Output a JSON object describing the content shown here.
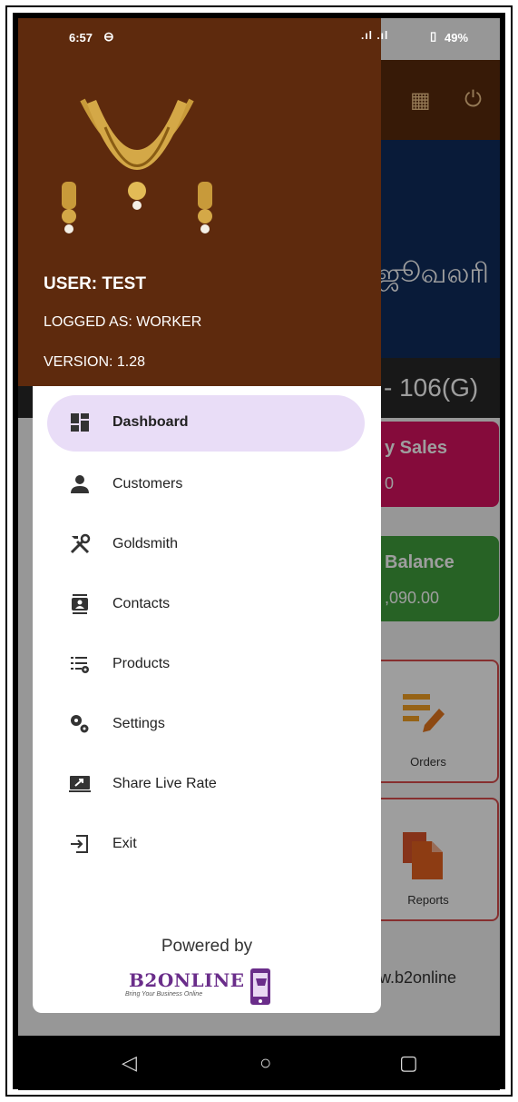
{
  "status_bar": {
    "time": "6:57",
    "signal": ".ıl .ıl",
    "battery": "49%"
  },
  "drawer": {
    "user": "USER: TEST",
    "logged_as": "LOGGED AS: WORKER",
    "version": "VERSION: 1.28",
    "menu": [
      {
        "label": "Dashboard",
        "icon": "dashboard-icon",
        "active": true
      },
      {
        "label": "Customers",
        "icon": "person-icon",
        "active": false
      },
      {
        "label": "Goldsmith",
        "icon": "tools-icon",
        "active": false
      },
      {
        "label": "Contacts",
        "icon": "contacts-icon",
        "active": false
      },
      {
        "label": "Products",
        "icon": "list-settings-icon",
        "active": false
      },
      {
        "label": "Settings",
        "icon": "gears-icon",
        "active": false
      },
      {
        "label": "Share Live Rate",
        "icon": "share-screen-icon",
        "active": false
      },
      {
        "label": "Exit",
        "icon": "exit-icon",
        "active": false
      }
    ],
    "powered_by": "Powered by",
    "brand": "B2ONLINE",
    "brand_tagline": "Bring Your Business Online"
  },
  "background_app": {
    "banner_text": "ஜூவலரி",
    "banner_small": "",
    "title_strip": "- 106(G)",
    "cards": [
      {
        "line1": "y Sales",
        "line2": "0",
        "color": "#d7125f"
      },
      {
        "line1": "Balance",
        "line2": ",090.00",
        "color": "#3f9f3d"
      }
    ],
    "tiles": [
      {
        "label": "Orders",
        "icon": "orders-icon"
      },
      {
        "label": "Reports",
        "icon": "reports-icon"
      }
    ],
    "website": "w.b2online"
  },
  "colors": {
    "drawer_header": "#5e2a0d",
    "active_item": "#e9ddf7",
    "brand": "#6a2d8a"
  }
}
